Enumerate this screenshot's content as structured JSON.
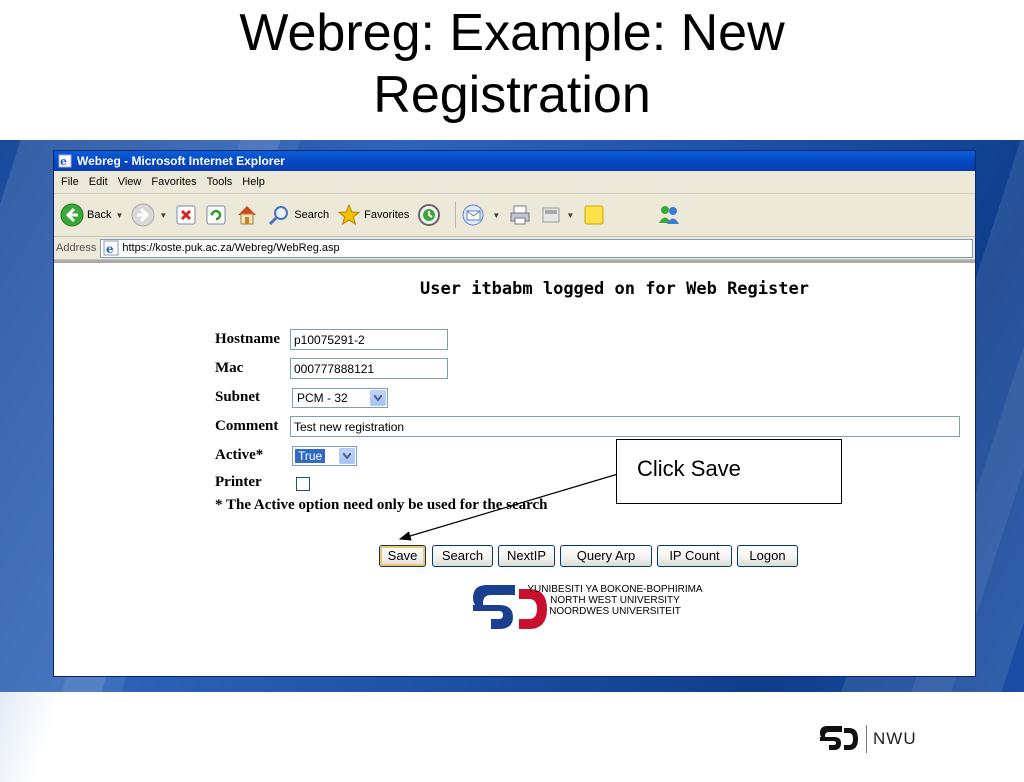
{
  "slide": {
    "title_line1": "Webreg: Example: New",
    "title_line2": "Registration"
  },
  "browser": {
    "window_title": "Webreg - Microsoft Internet Explorer",
    "menu": [
      "File",
      "Edit",
      "View",
      "Favorites",
      "Tools",
      "Help"
    ],
    "toolbar": {
      "back_label": "Back",
      "search_label": "Search",
      "favorites_label": "Favorites"
    },
    "address": {
      "label": "Address",
      "url": "https://koste.puk.ac.za/Webreg/WebReg.asp"
    }
  },
  "page": {
    "heading": "User itbabm logged on for Web Register",
    "form": {
      "hostname_label": "Hostname",
      "hostname_value": "p10075291-2",
      "mac_label": "Mac",
      "mac_value": "000777888121",
      "subnet_label": "Subnet",
      "subnet_value": "PCM - 32",
      "comment_label": "Comment",
      "comment_value": "Test new registration",
      "active_label": "Active*",
      "active_value": "True",
      "printer_label": "Printer",
      "printer_checked": false
    },
    "note": "* The Active option need only be used for the search",
    "buttons": {
      "save": "Save",
      "search": "Search",
      "nextip": "NextIP",
      "query_arp": "Query Arp",
      "ip_count": "IP Count",
      "logon": "Logon"
    },
    "logo_text": {
      "line1": "YUNIBESITI YA BOKONE-BOPHIRIMA",
      "line2": "NORTH WEST UNIVERSITY",
      "line3": "NOORDWES UNIVERSITEIT"
    }
  },
  "callout": {
    "text": "Click Save"
  },
  "footer": {
    "logo_text": "NWU"
  },
  "colors": {
    "brand_blue": "#1b3f8f",
    "brand_red": "#c8102e",
    "band_blue": "#1d52a6",
    "titlebar_blue": "#0648c4"
  }
}
